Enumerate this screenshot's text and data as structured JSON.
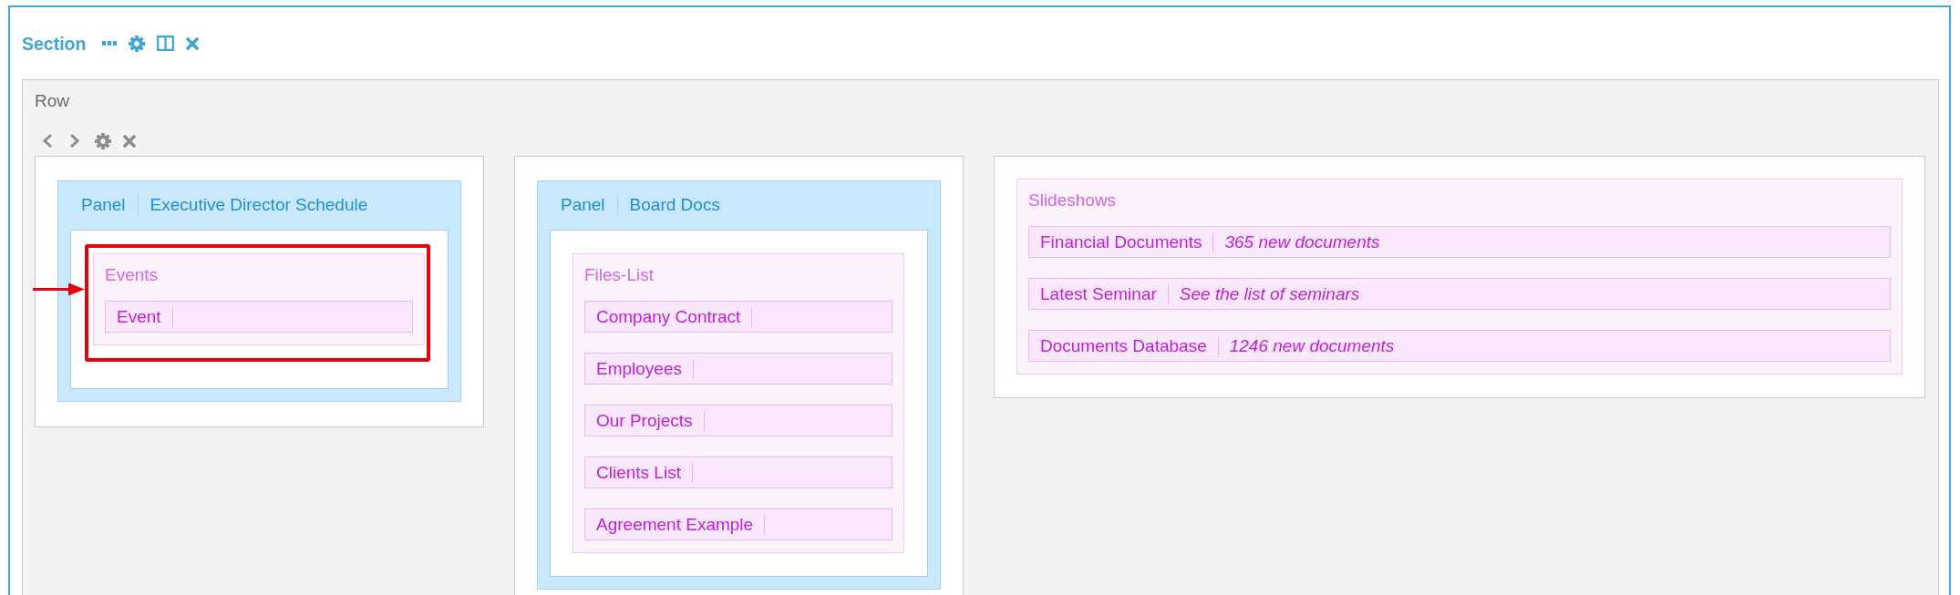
{
  "section": {
    "title": "Section"
  },
  "row": {
    "label": "Row"
  },
  "columns": [
    {
      "kind": "panel",
      "panel": {
        "label": "Panel",
        "title": "Executive Director Schedule"
      },
      "list": {
        "title": "Events",
        "highlighted": true,
        "items": [
          {
            "label": "Event"
          }
        ]
      }
    },
    {
      "kind": "panel",
      "panel": {
        "label": "Panel",
        "title": "Board Docs"
      },
      "list": {
        "title": "Files-List",
        "highlighted": false,
        "items": [
          {
            "label": "Company Contract"
          },
          {
            "label": "Employees"
          },
          {
            "label": "Our Projects"
          },
          {
            "label": "Clients List"
          },
          {
            "label": "Agreement Example"
          }
        ]
      }
    },
    {
      "kind": "list",
      "list": {
        "title": "Slideshows",
        "highlighted": false,
        "items": [
          {
            "label": "Financial Documents",
            "note": "365 new documents"
          },
          {
            "label": "Latest Seminar",
            "note": "See the list of seminars"
          },
          {
            "label": "Documents Database",
            "note": "1246 new documents"
          }
        ]
      }
    }
  ]
}
